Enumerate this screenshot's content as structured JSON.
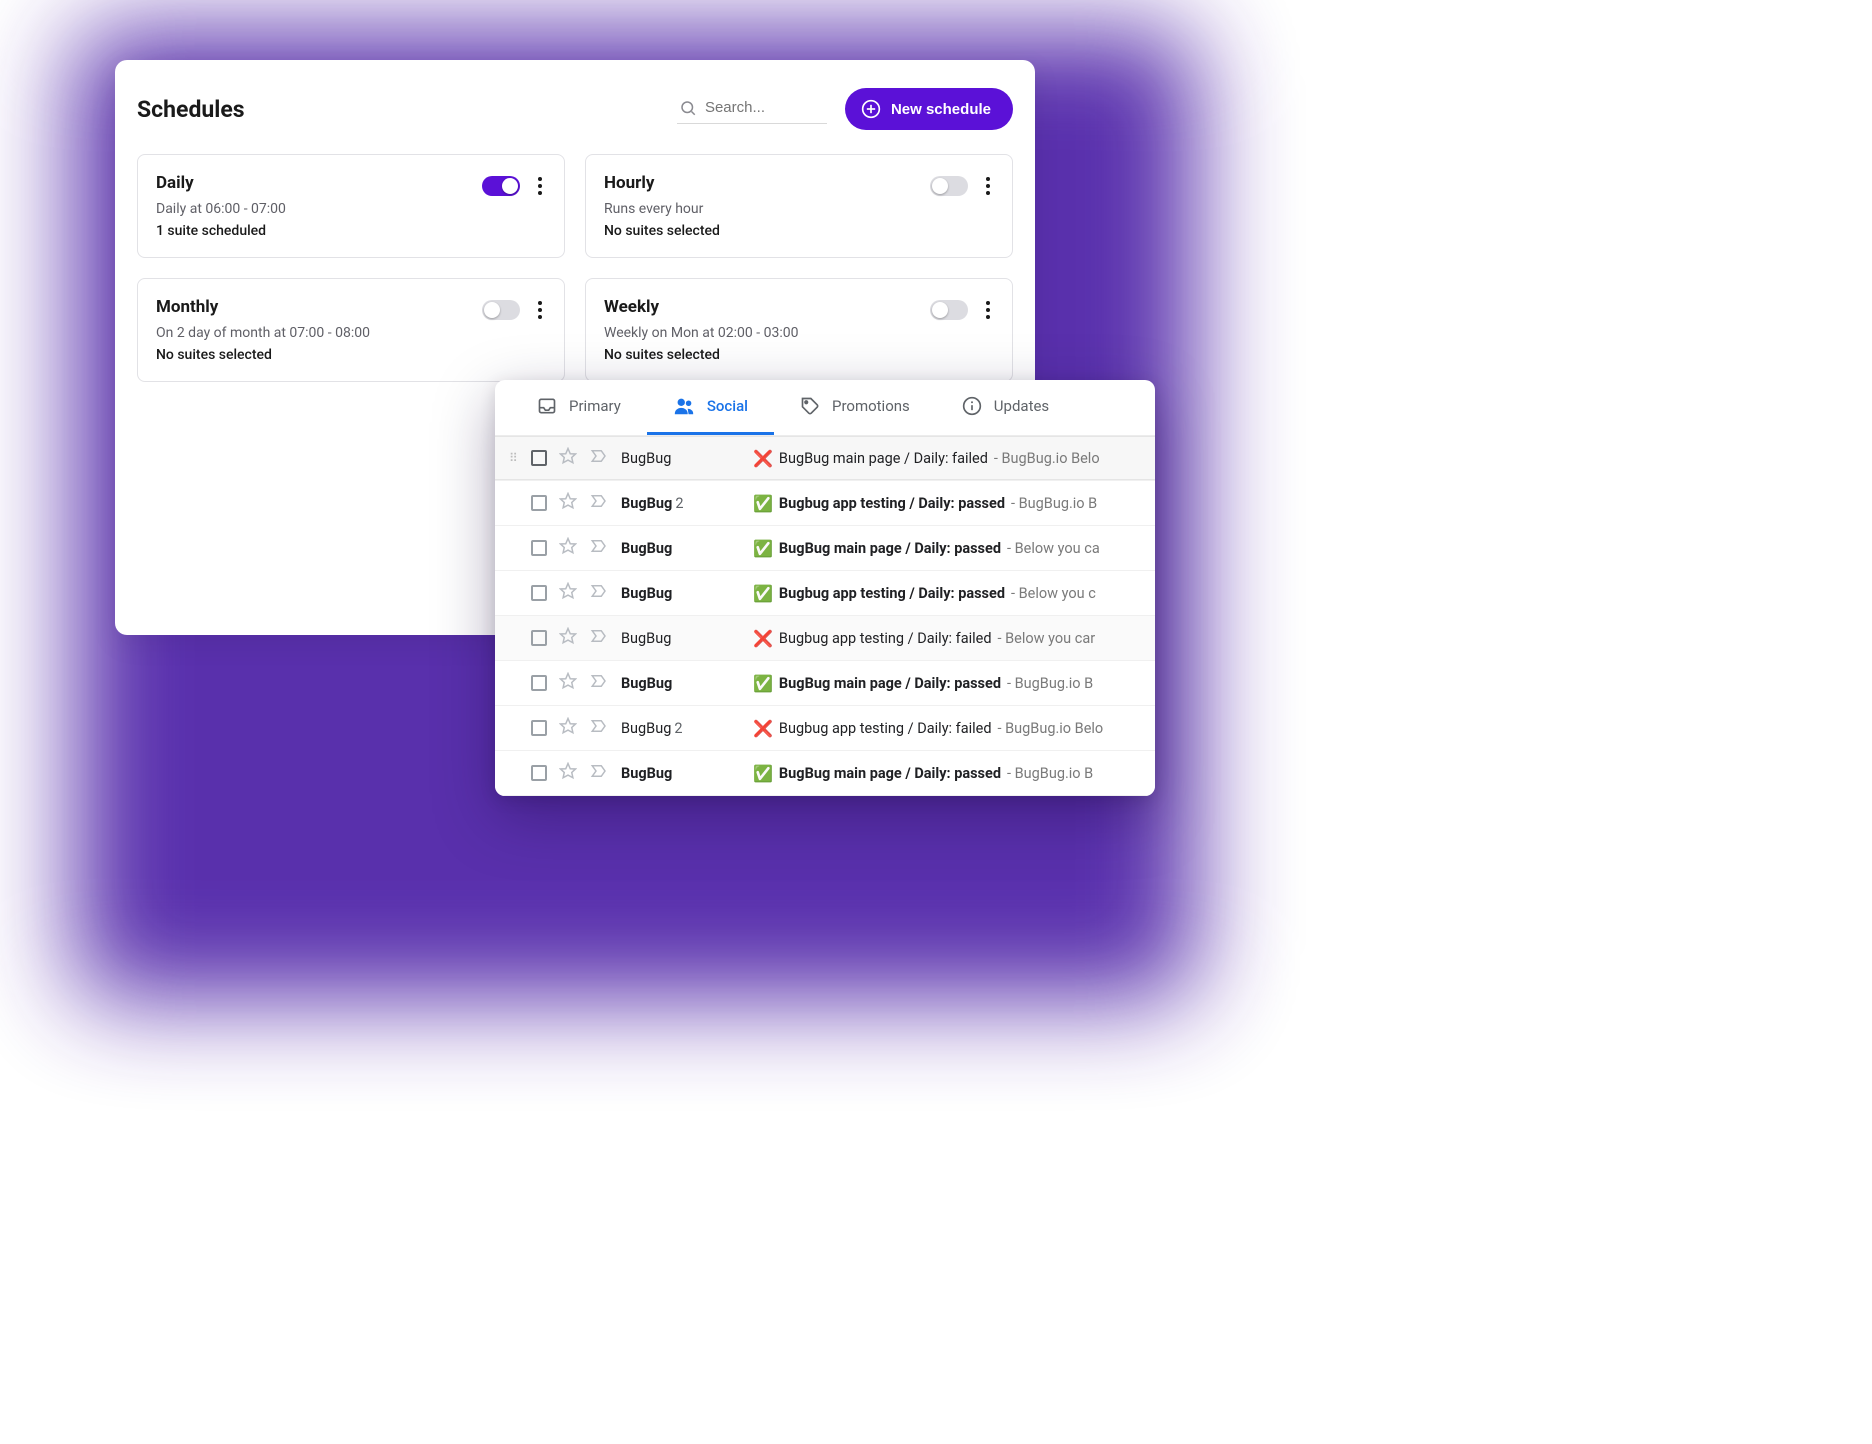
{
  "schedules": {
    "title": "Schedules",
    "search_placeholder": "Search...",
    "new_button": "New schedule",
    "cards": [
      {
        "title": "Daily",
        "sub": "Daily at 06:00 - 07:00",
        "status": "1 suite scheduled",
        "enabled": true
      },
      {
        "title": "Hourly",
        "sub": "Runs every hour",
        "status": "No suites selected",
        "enabled": false
      },
      {
        "title": "Monthly",
        "sub": "On 2 day of month at 07:00 - 08:00",
        "status": "No suites selected",
        "enabled": false
      },
      {
        "title": "Weekly",
        "sub": "Weekly on Mon at 02:00 - 03:00",
        "status": "No suites selected",
        "enabled": false
      }
    ]
  },
  "inbox": {
    "tabs": [
      {
        "label": "Primary",
        "icon": "inbox",
        "active": false
      },
      {
        "label": "Social",
        "icon": "people",
        "active": true
      },
      {
        "label": "Promotions",
        "icon": "tag",
        "active": false
      },
      {
        "label": "Updates",
        "icon": "info",
        "active": false
      }
    ],
    "rows": [
      {
        "sender": "BugBug",
        "count": "",
        "bold": false,
        "status": "fail",
        "subject": "BugBug main page / Daily: failed",
        "tail": " - BugBug.io Belo",
        "hover": true
      },
      {
        "sender": "BugBug",
        "count": "2",
        "bold": true,
        "status": "pass",
        "subject": "Bugbug app testing / Daily: passed",
        "tail": " - BugBug.io B"
      },
      {
        "sender": "BugBug",
        "count": "",
        "bold": true,
        "status": "pass",
        "subject": "BugBug main page / Daily: passed",
        "tail": " - Below you ca"
      },
      {
        "sender": "BugBug",
        "count": "",
        "bold": true,
        "status": "pass",
        "subject": "Bugbug app testing / Daily: passed",
        "tail": " - Below you c"
      },
      {
        "sender": "BugBug",
        "count": "",
        "bold": false,
        "status": "fail",
        "subject": "Bugbug app testing / Daily: failed",
        "tail": " - Below you car",
        "shaded": true
      },
      {
        "sender": "BugBug",
        "count": "",
        "bold": true,
        "status": "pass",
        "subject": "BugBug main page / Daily: passed",
        "tail": " - BugBug.io B"
      },
      {
        "sender": "BugBug",
        "count": "2",
        "bold": false,
        "status": "fail",
        "subject": "Bugbug app testing / Daily: failed",
        "tail": " - BugBug.io Belo"
      },
      {
        "sender": "BugBug",
        "count": "",
        "bold": true,
        "status": "pass",
        "subject": "BugBug main page / Daily: passed",
        "tail": " - BugBug.io B"
      }
    ]
  },
  "colors": {
    "accent": "#5b11d7",
    "gmail_blue": "#1a73e8"
  }
}
